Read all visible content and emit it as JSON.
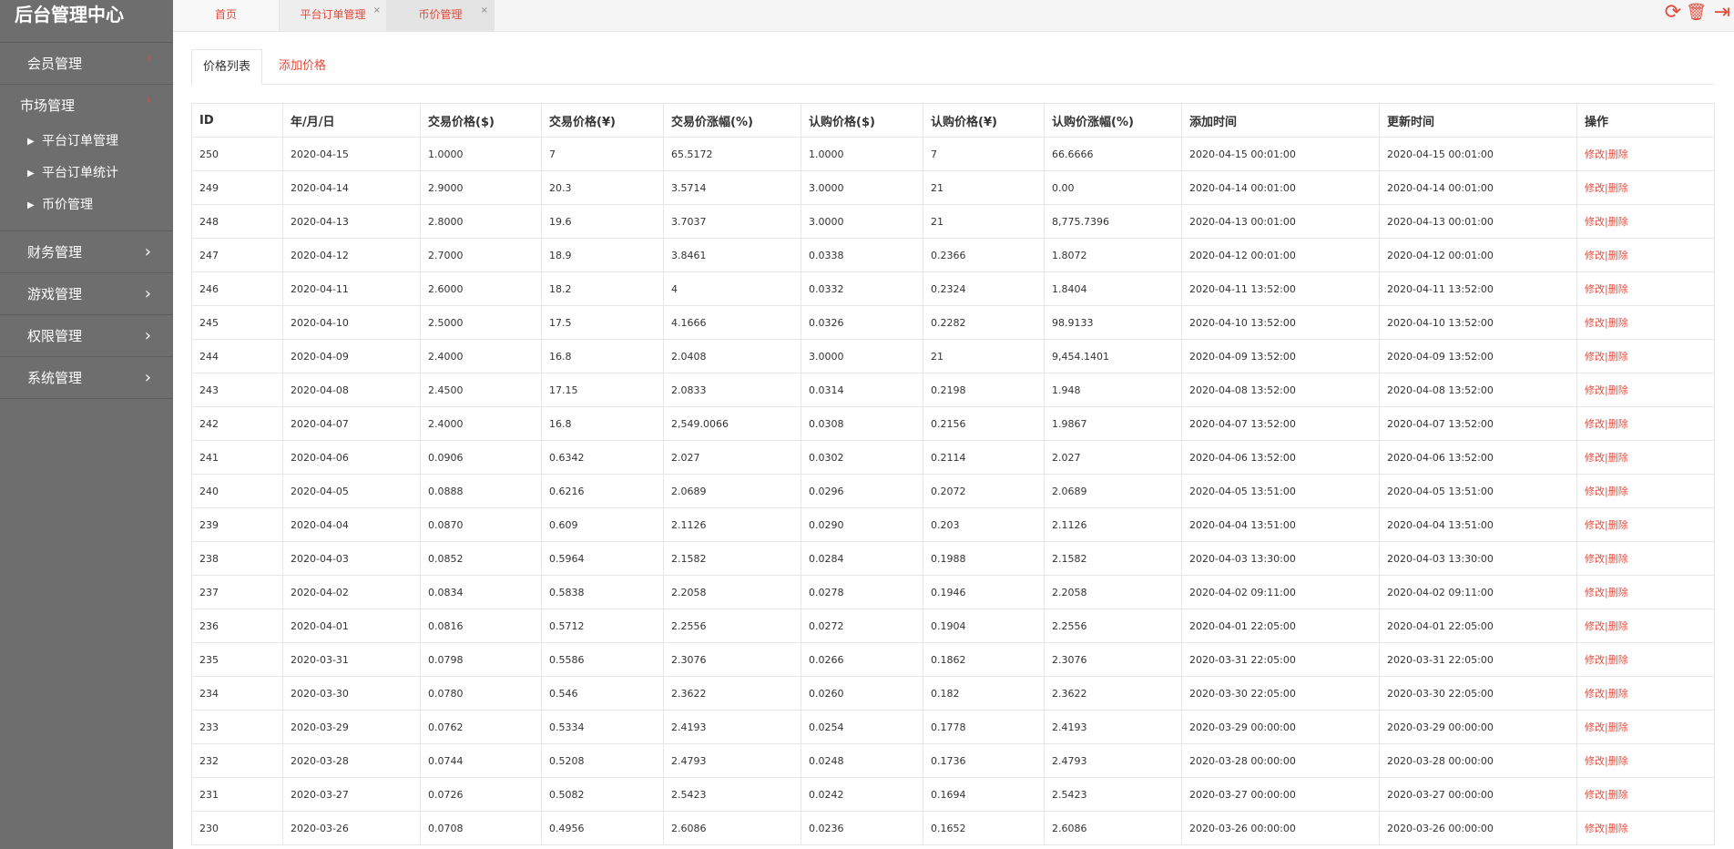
{
  "app": {
    "title": "后台管理中心"
  },
  "sidebar": {
    "items": [
      {
        "label": "会员管理",
        "chevron": "›"
      },
      {
        "label": "市场管理",
        "chevron": "›",
        "children": [
          {
            "label": "平台订单管理"
          },
          {
            "label": "平台订单统计"
          },
          {
            "label": "币价管理"
          }
        ]
      },
      {
        "label": "财务管理",
        "chevron": "›"
      },
      {
        "label": "游戏管理",
        "chevron": "›"
      },
      {
        "label": "权限管理",
        "chevron": "›"
      },
      {
        "label": "系统管理",
        "chevron": "›"
      }
    ]
  },
  "topbar": {
    "tabs": [
      {
        "label": "首页"
      },
      {
        "label": "平台订单管理",
        "close": "×"
      },
      {
        "label": "币价管理",
        "close": "×"
      }
    ],
    "actions": {
      "refresh": "⟳",
      "trash": "🗑",
      "logout": "⇥"
    }
  },
  "page": {
    "tabs": [
      {
        "label": "价格列表"
      },
      {
        "label": "添加价格"
      }
    ]
  },
  "table": {
    "columns": [
      "ID",
      "年/月/日",
      "交易价格($)",
      "交易价格(¥)",
      "交易价涨幅(%)",
      "认购价格($)",
      "认购价格(¥)",
      "认购价涨幅(%)",
      "添加时间",
      "更新时间",
      "操作"
    ],
    "edit_label": "修改",
    "delete_label": "删除",
    "separator": "|",
    "rows": [
      [
        "250",
        "2020-04-15",
        "1.0000",
        "7",
        "65.5172",
        "1.0000",
        "7",
        "66.6666",
        "2020-04-15 00:01:00",
        "2020-04-15 00:01:00"
      ],
      [
        "249",
        "2020-04-14",
        "2.9000",
        "20.3",
        "3.5714",
        "3.0000",
        "21",
        "0.00",
        "2020-04-14 00:01:00",
        "2020-04-14 00:01:00"
      ],
      [
        "248",
        "2020-04-13",
        "2.8000",
        "19.6",
        "3.7037",
        "3.0000",
        "21",
        "8,775.7396",
        "2020-04-13 00:01:00",
        "2020-04-13 00:01:00"
      ],
      [
        "247",
        "2020-04-12",
        "2.7000",
        "18.9",
        "3.8461",
        "0.0338",
        "0.2366",
        "1.8072",
        "2020-04-12 00:01:00",
        "2020-04-12 00:01:00"
      ],
      [
        "246",
        "2020-04-11",
        "2.6000",
        "18.2",
        "4",
        "0.0332",
        "0.2324",
        "1.8404",
        "2020-04-11 13:52:00",
        "2020-04-11 13:52:00"
      ],
      [
        "245",
        "2020-04-10",
        "2.5000",
        "17.5",
        "4.1666",
        "0.0326",
        "0.2282",
        "98.9133",
        "2020-04-10 13:52:00",
        "2020-04-10 13:52:00"
      ],
      [
        "244",
        "2020-04-09",
        "2.4000",
        "16.8",
        "2.0408",
        "3.0000",
        "21",
        "9,454.1401",
        "2020-04-09 13:52:00",
        "2020-04-09 13:52:00"
      ],
      [
        "243",
        "2020-04-08",
        "2.4500",
        "17.15",
        "2.0833",
        "0.0314",
        "0.2198",
        "1.948",
        "2020-04-08 13:52:00",
        "2020-04-08 13:52:00"
      ],
      [
        "242",
        "2020-04-07",
        "2.4000",
        "16.8",
        "2,549.0066",
        "0.0308",
        "0.2156",
        "1.9867",
        "2020-04-07 13:52:00",
        "2020-04-07 13:52:00"
      ],
      [
        "241",
        "2020-04-06",
        "0.0906",
        "0.6342",
        "2.027",
        "0.0302",
        "0.2114",
        "2.027",
        "2020-04-06 13:52:00",
        "2020-04-06 13:52:00"
      ],
      [
        "240",
        "2020-04-05",
        "0.0888",
        "0.6216",
        "2.0689",
        "0.0296",
        "0.2072",
        "2.0689",
        "2020-04-05 13:51:00",
        "2020-04-05 13:51:00"
      ],
      [
        "239",
        "2020-04-04",
        "0.0870",
        "0.609",
        "2.1126",
        "0.0290",
        "0.203",
        "2.1126",
        "2020-04-04 13:51:00",
        "2020-04-04 13:51:00"
      ],
      [
        "238",
        "2020-04-03",
        "0.0852",
        "0.5964",
        "2.1582",
        "0.0284",
        "0.1988",
        "2.1582",
        "2020-04-03 13:30:00",
        "2020-04-03 13:30:00"
      ],
      [
        "237",
        "2020-04-02",
        "0.0834",
        "0.5838",
        "2.2058",
        "0.0278",
        "0.1946",
        "2.2058",
        "2020-04-02 09:11:00",
        "2020-04-02 09:11:00"
      ],
      [
        "236",
        "2020-04-01",
        "0.0816",
        "0.5712",
        "2.2556",
        "0.0272",
        "0.1904",
        "2.2556",
        "2020-04-01 22:05:00",
        "2020-04-01 22:05:00"
      ],
      [
        "235",
        "2020-03-31",
        "0.0798",
        "0.5586",
        "2.3076",
        "0.0266",
        "0.1862",
        "2.3076",
        "2020-03-31 22:05:00",
        "2020-03-31 22:05:00"
      ],
      [
        "234",
        "2020-03-30",
        "0.0780",
        "0.546",
        "2.3622",
        "0.0260",
        "0.182",
        "2.3622",
        "2020-03-30 22:05:00",
        "2020-03-30 22:05:00"
      ],
      [
        "233",
        "2020-03-29",
        "0.0762",
        "0.5334",
        "2.4193",
        "0.0254",
        "0.1778",
        "2.4193",
        "2020-03-29 00:00:00",
        "2020-03-29 00:00:00"
      ],
      [
        "232",
        "2020-03-28",
        "0.0744",
        "0.5208",
        "2.4793",
        "0.0248",
        "0.1736",
        "2.4793",
        "2020-03-28 00:00:00",
        "2020-03-28 00:00:00"
      ],
      [
        "231",
        "2020-03-27",
        "0.0726",
        "0.5082",
        "2.5423",
        "0.0242",
        "0.1694",
        "2.5423",
        "2020-03-27 00:00:00",
        "2020-03-27 00:00:00"
      ],
      [
        "230",
        "2020-03-26",
        "0.0708",
        "0.4956",
        "2.6086",
        "0.0236",
        "0.1652",
        "2.6086",
        "2020-03-26 00:00:00",
        "2020-03-26 00:00:00"
      ]
    ]
  },
  "colors": {
    "accent": "#e34b3b",
    "sidebar_bg": "#6e6e6e"
  }
}
